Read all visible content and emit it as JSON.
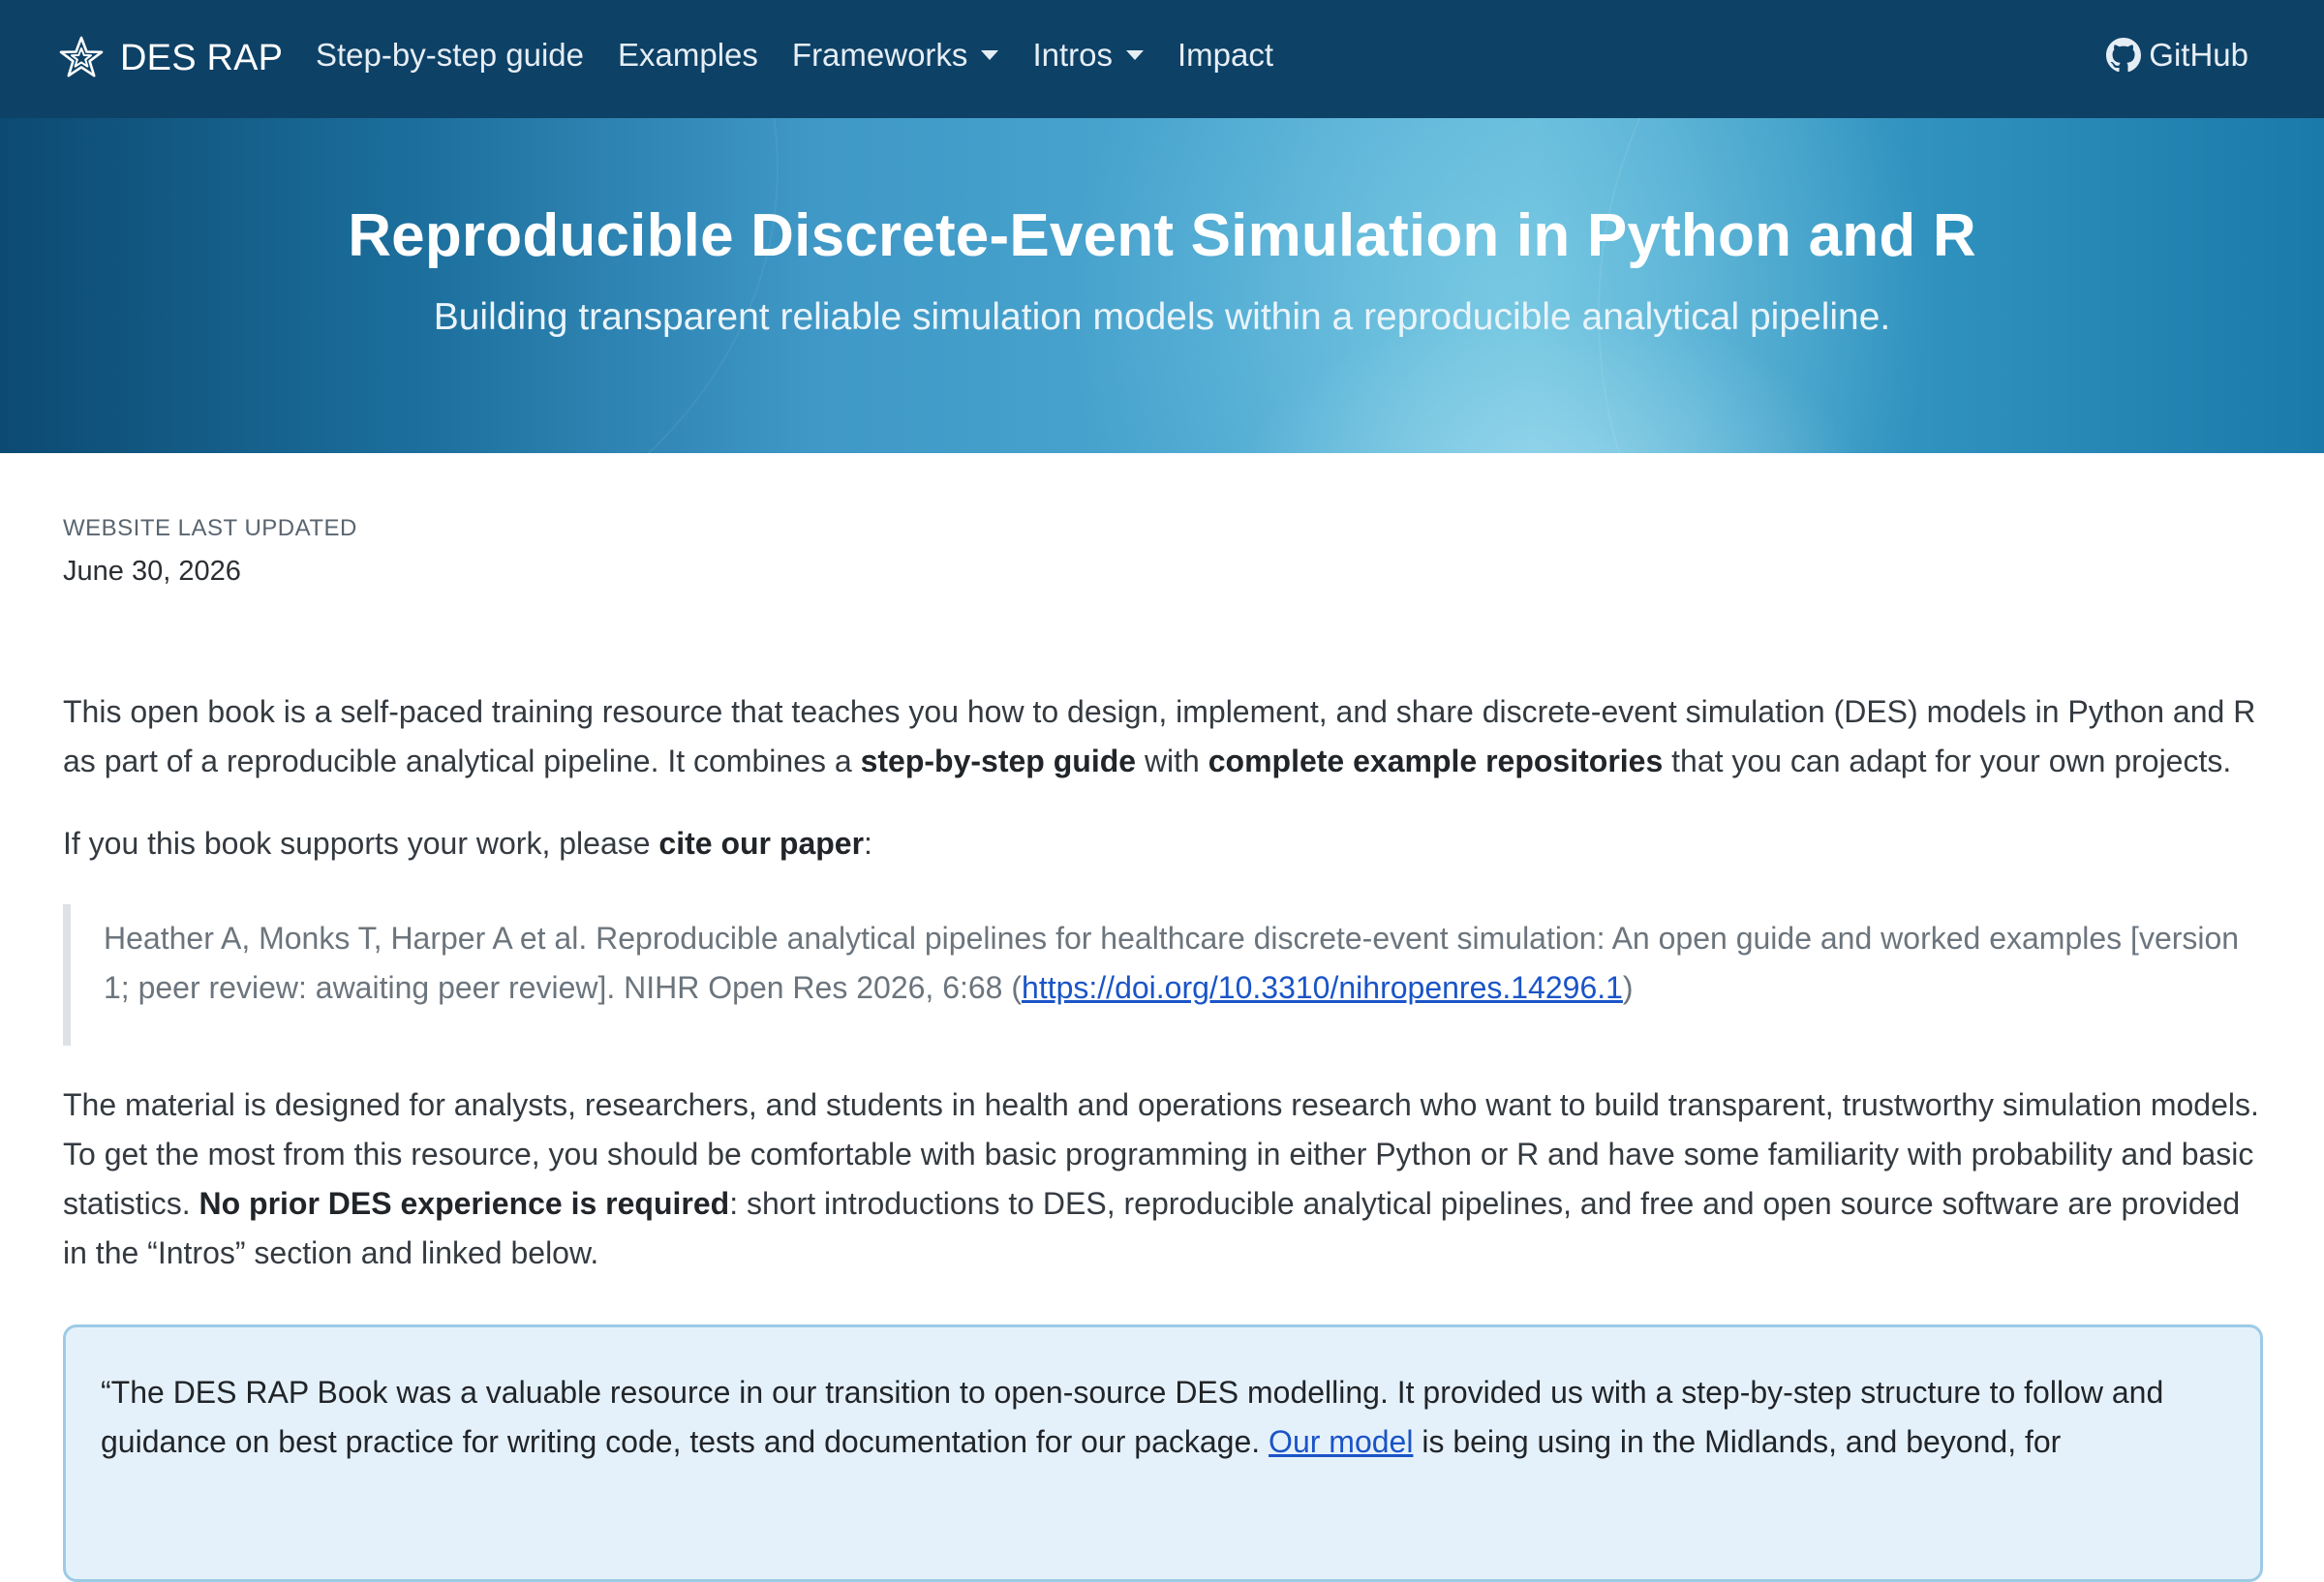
{
  "navbar": {
    "brand": "DES RAP",
    "items": [
      {
        "label": "Step-by-step guide",
        "dropdown": false
      },
      {
        "label": "Examples",
        "dropdown": false
      },
      {
        "label": "Frameworks",
        "dropdown": true
      },
      {
        "label": "Intros",
        "dropdown": true
      },
      {
        "label": "Impact",
        "dropdown": false
      }
    ],
    "github": "GitHub"
  },
  "hero": {
    "title": "Reproducible Discrete-Event Simulation in Python and R",
    "subtitle": "Building transparent reliable simulation models within a reproducible analytical pipeline."
  },
  "meta": {
    "label": "WEBSITE LAST UPDATED",
    "date": "June 30, 2026"
  },
  "intro": {
    "p1_a": "This open book is a self-paced training resource that teaches you how to design, implement, and share discrete-event simulation (DES) models in Python and R as part of a reproducible analytical pipeline. It combines a ",
    "p1_b": "step-by-step guide",
    "p1_c": " with ",
    "p1_d": "complete example repositories",
    "p1_e": " that you can adapt for your own projects.",
    "p2_a": "If you this book supports your work, please ",
    "p2_b": "cite our paper",
    "p2_c": ":"
  },
  "citation": {
    "text": "Heather A, Monks T, Harper A et al. Reproducible analytical pipelines for healthcare discrete-event simulation: An open guide and worked examples [version 1; peer review: awaiting peer review]. NIHR Open Res 2026, 6:68 (",
    "link": "https://doi.org/10.3310/nihropenres.14296.1",
    "close": ")"
  },
  "audience": {
    "a": "The material is designed for analysts, researchers, and students in health and operations research who want to build transparent, trustworthy simulation models. To get the most from this resource, you should be comfortable with basic programming in either Python or R and have some familiarity with probability and basic statistics. ",
    "b": "No prior DES experience is required",
    "c": ": short introductions to DES, reproducible analytical pipelines, and free and open source software are provided in the “Intros” section and linked below."
  },
  "testimonial": {
    "a": "“The DES RAP Book was a valuable resource in our transition to open-source DES modelling. It provided us with a step-by-step structure to follow and guidance on best practice for writing code, tests and documentation for our package. ",
    "link": "Our model",
    "b": " is being using in the Midlands, and beyond, for"
  },
  "colors": {
    "navbar_bg": "#0e4166",
    "hero_accent": "#4aa6cf",
    "link": "#1a54c7",
    "callout_bg": "#e5f1fa",
    "callout_border": "#9ccbe6"
  }
}
